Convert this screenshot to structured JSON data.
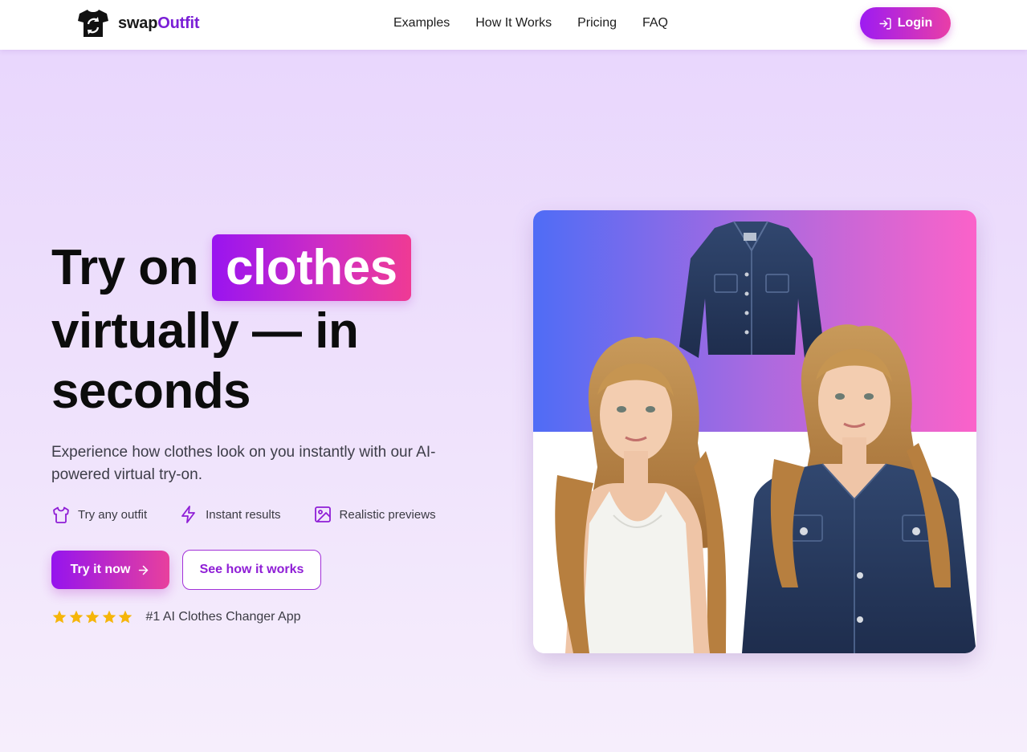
{
  "header": {
    "logo_swap": "swap",
    "logo_outfit": "Outfit",
    "nav": [
      "Examples",
      "How It Works",
      "Pricing",
      "FAQ"
    ],
    "login_label": "Login"
  },
  "hero": {
    "headline_part1": "Try on",
    "headline_highlight": "clothes",
    "headline_line2": "virtually — in",
    "headline_line3": "seconds",
    "subtitle": "Experience how clothes look on you instantly with our AI-powered virtual try-on.",
    "features": [
      {
        "label": "Try any outfit",
        "icon": "shirt-icon"
      },
      {
        "label": "Instant results",
        "icon": "lightning-icon"
      },
      {
        "label": "Realistic previews",
        "icon": "image-icon"
      }
    ],
    "try_button": "Try it now",
    "see_button": "See how it works",
    "rating_text": "#1 AI Clothes Changer App",
    "rating_stars": 5
  },
  "colors": {
    "brand_purple": "#7a1fd6",
    "gradient_start": "#9914f0",
    "gradient_end": "#ef3a94",
    "star": "#f5b50a"
  }
}
